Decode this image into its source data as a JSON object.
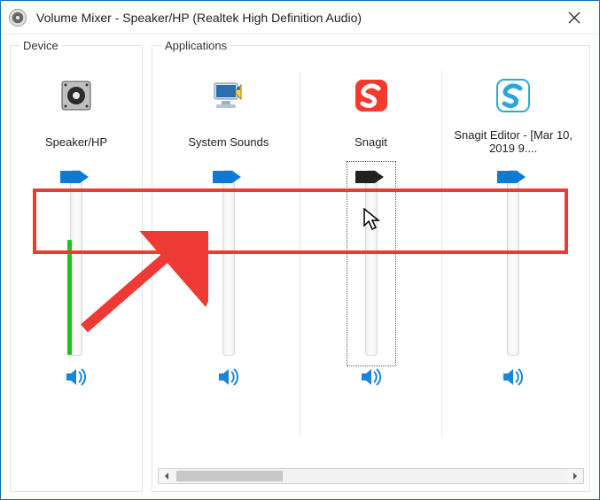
{
  "window": {
    "title": "Volume Mixer - Speaker/HP (Realtek High Definition Audio)"
  },
  "device_panel": {
    "label": "Device",
    "item": {
      "name": "Speaker/HP"
    }
  },
  "apps_panel": {
    "label": "Applications",
    "items": [
      {
        "name": "System Sounds"
      },
      {
        "name": "Snagit"
      },
      {
        "name": "Snagit Editor - [Mar 10, 2019 9...."
      }
    ]
  }
}
